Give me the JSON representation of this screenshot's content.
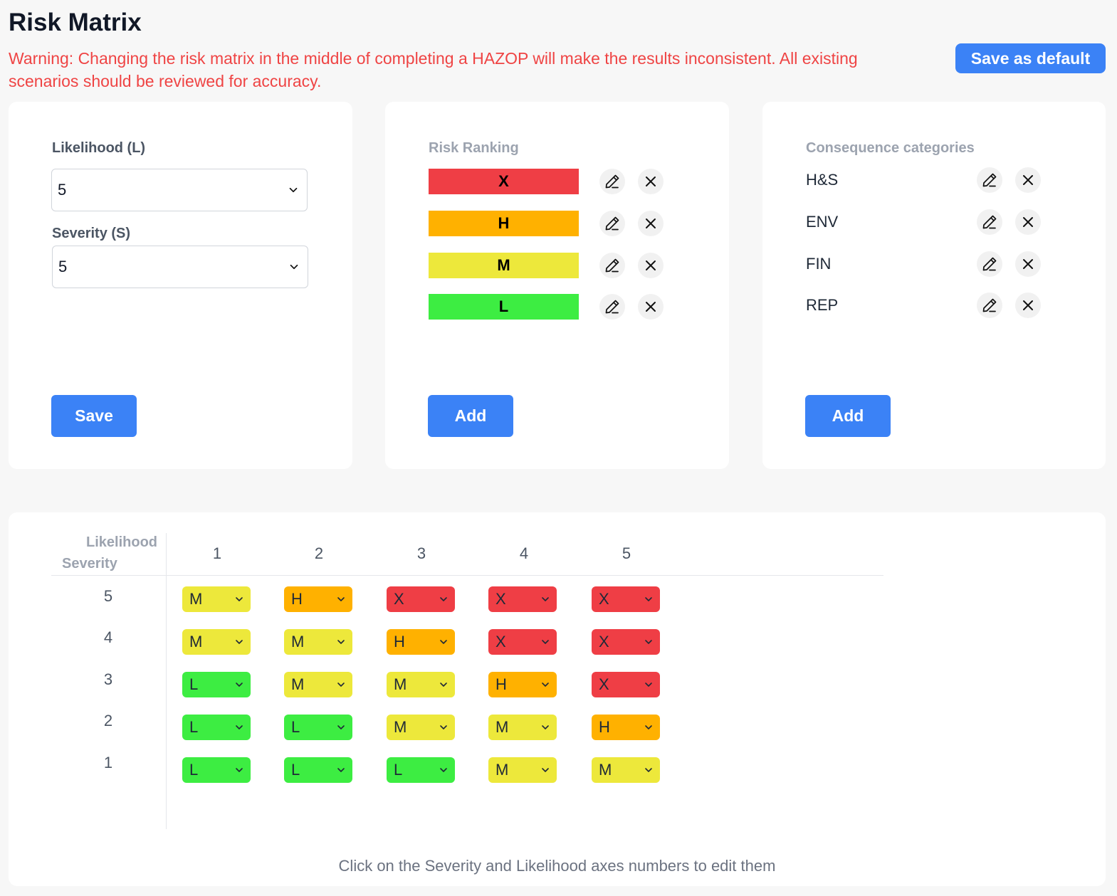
{
  "page_title": "Risk Matrix",
  "warning": "Warning: Changing the risk matrix in the middle of completing a HAZOP will make the results inconsistent. All existing scenarios should be reviewed for accuracy.",
  "save_default_label": "Save as default",
  "dimensions": {
    "likelihood_label": "Likelihood (L)",
    "likelihood_value": "5",
    "severity_label": "Severity (S)",
    "severity_value": "5",
    "save_label": "Save"
  },
  "risk_ranking": {
    "title": "Risk Ranking",
    "add_label": "Add",
    "items": [
      {
        "label": "X",
        "color": "#ef3e45"
      },
      {
        "label": "H",
        "color": "#ffb100"
      },
      {
        "label": "M",
        "color": "#ede83b"
      },
      {
        "label": "L",
        "color": "#3ded42"
      }
    ]
  },
  "consequences": {
    "title": "Consequence categories",
    "add_label": "Add",
    "items": [
      "H&S",
      "ENV",
      "FIN",
      "REP"
    ]
  },
  "matrix": {
    "likelihood_axis_label": "Likelihood",
    "severity_axis_label": "Severity",
    "likelihood_values": [
      "1",
      "2",
      "3",
      "4",
      "5"
    ],
    "severity_values": [
      "5",
      "4",
      "3",
      "2",
      "1"
    ],
    "cells": [
      [
        "M",
        "H",
        "X",
        "X",
        "X"
      ],
      [
        "M",
        "M",
        "H",
        "X",
        "X"
      ],
      [
        "L",
        "M",
        "M",
        "H",
        "X"
      ],
      [
        "L",
        "L",
        "M",
        "M",
        "H"
      ],
      [
        "L",
        "L",
        "L",
        "M",
        "M"
      ]
    ],
    "hint": "Click on the Severity and Likelihood axes numbers to edit them"
  },
  "icons": {
    "edit": "pencil-icon",
    "delete": "close-icon",
    "dropdown": "chevron-down-icon"
  }
}
